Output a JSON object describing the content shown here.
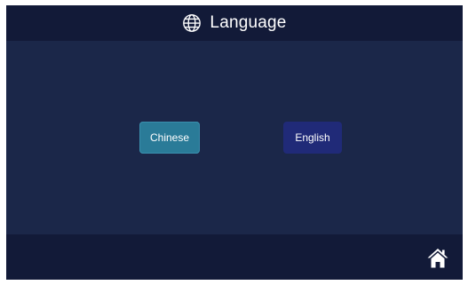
{
  "header": {
    "title": "Language",
    "icon": "globe-icon"
  },
  "languages": [
    {
      "label": "Chinese",
      "selected": true
    },
    {
      "label": "English",
      "selected": false
    }
  ],
  "footer": {
    "home_icon": "home-icon"
  },
  "colors": {
    "background": "#1b2749",
    "bar": "#121a38",
    "selected_button": "#2a7b98",
    "unselected_button": "#202a78",
    "text": "#ffffff"
  }
}
